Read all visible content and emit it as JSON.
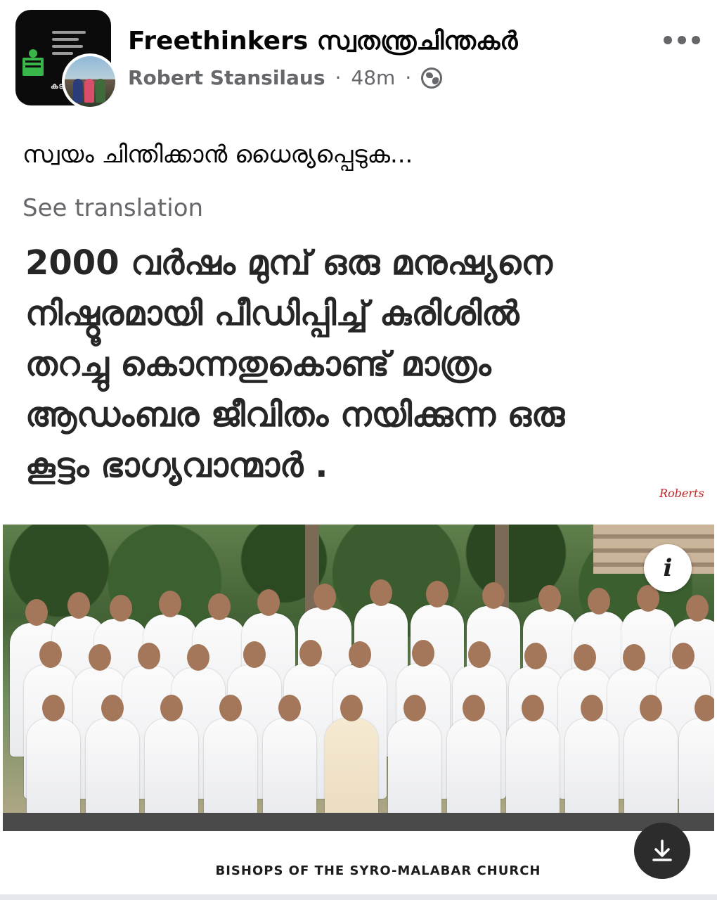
{
  "post": {
    "group_name": "Freethinkers സ്വതന്ത്രചിന്തകർ",
    "author": "Robert Stansilaus",
    "time": "48m",
    "separator": "·",
    "privacy_icon": "globe-icon",
    "more_icon": "more-horizontal-icon",
    "group_avatar_word": "കടമയ",
    "caption": "സ്വയം ചിന്തിക്കാൻ ധൈര്യപ്പെടുക...",
    "see_translation": "See translation"
  },
  "shared_image": {
    "headline_lines": [
      "2000 വർഷം മുമ്പ് ഒരു മനുഷ്യനെ",
      "നിഷ്ഠൂരമായി പീഡിപ്പിച്ച് കുരിശിൽ",
      "തറച്ചു കൊന്നതുകൊണ്ട് മാത്രം",
      "ആഡംബര ജീവിതം നയിക്കുന്ന ഒരു",
      "കൂട്ടം ഭാഗ്യവാന്മാർ ."
    ],
    "signature": "Roberts",
    "info_label": "i",
    "info_icon": "info-icon",
    "download_icon": "download-icon",
    "photo_caption": "BISHOPS OF THE SYRO-MALABAR CHURCH"
  },
  "colors": {
    "text_primary": "#050505",
    "text_secondary": "#65676b",
    "signature": "#c12222",
    "download_bg": "#2c2c2c"
  }
}
